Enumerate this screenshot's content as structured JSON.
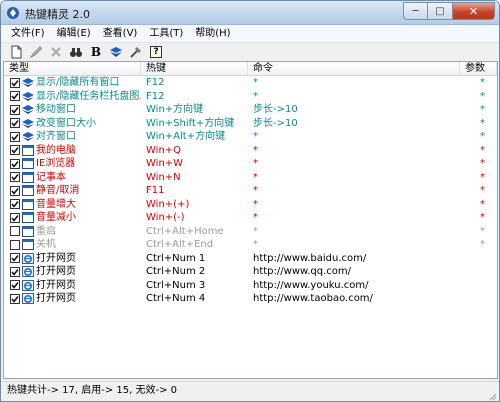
{
  "window": {
    "title": "热键精灵 2.0",
    "min_glyph": "─",
    "max_glyph": "□",
    "close_glyph": "✕"
  },
  "menu": [
    "文件(F)",
    "编辑(E)",
    "查看(V)",
    "工具(T)",
    "帮助(H)"
  ],
  "toolbar": {
    "icons": [
      "new-icon",
      "edit-icon",
      "delete-icon",
      "find-icon",
      "bold-icon",
      "hide-icon",
      "options-icon",
      "help-icon"
    ],
    "bold_glyph": "B",
    "help_glyph": "?"
  },
  "columns": [
    "类型",
    "热键",
    "命令",
    "参数"
  ],
  "colors": {
    "teal": "#0a8a8a",
    "red": "#d40000",
    "gray": "#9a9a9a",
    "black": "#000000"
  },
  "rows": [
    {
      "type": "显示/隐藏所有窗口",
      "hotkey": "F12",
      "command": "*",
      "param": "*",
      "checked": true,
      "icon": "diamond-icon",
      "color": "#0a8a8a"
    },
    {
      "type": "显示/隐藏任务栏托盘图...",
      "hotkey": "F12",
      "command": "*",
      "param": "*",
      "checked": true,
      "icon": "diamond-icon",
      "color": "#0a8a8a"
    },
    {
      "type": "移动窗口",
      "hotkey": "Win+方向键",
      "command": "步长->10",
      "param": "*",
      "checked": true,
      "icon": "diamond-icon",
      "color": "#0a8a8a"
    },
    {
      "type": "改变窗口大小",
      "hotkey": "Win+Shift+方向键",
      "command": "步长->10",
      "param": "*",
      "checked": true,
      "icon": "diamond-icon",
      "color": "#0a8a8a"
    },
    {
      "type": "对齐窗口",
      "hotkey": "Win+Alt+方向键",
      "command": "*",
      "param": "*",
      "checked": true,
      "icon": "diamond-icon",
      "color": "#0a8a8a"
    },
    {
      "type": "我的电脑",
      "hotkey": "Win+Q",
      "command": "*",
      "param": "*",
      "checked": true,
      "icon": "window-icon",
      "color": "#d40000"
    },
    {
      "type": "IE浏览器",
      "hotkey": "Win+W",
      "command": "*",
      "param": "*",
      "checked": true,
      "icon": "window-icon",
      "color": "#d40000"
    },
    {
      "type": "记事本",
      "hotkey": "Win+N",
      "command": "*",
      "param": "*",
      "checked": true,
      "icon": "window-icon",
      "color": "#d40000"
    },
    {
      "type": "静音/取消",
      "hotkey": "F11",
      "command": "*",
      "param": "*",
      "checked": true,
      "icon": "window-icon",
      "color": "#d40000"
    },
    {
      "type": "音量增大",
      "hotkey": "Win+(+)",
      "command": "*",
      "param": "*",
      "checked": true,
      "icon": "window-icon",
      "color": "#d40000"
    },
    {
      "type": "音量减小",
      "hotkey": "Win+(-)",
      "command": "*",
      "param": "*",
      "checked": true,
      "icon": "window-icon",
      "color": "#d40000"
    },
    {
      "type": "重启",
      "hotkey": "Ctrl+Alt+Home",
      "command": "*",
      "param": "*",
      "checked": false,
      "icon": "window-icon",
      "color": "#9a9a9a"
    },
    {
      "type": "关机",
      "hotkey": "Ctrl+Alt+End",
      "command": "*",
      "param": "*",
      "checked": false,
      "icon": "window-icon",
      "color": "#9a9a9a"
    },
    {
      "type": "打开网页",
      "hotkey": "Ctrl+Num 1",
      "command": "http://www.baidu.com/",
      "param": "",
      "checked": true,
      "icon": "ie-icon",
      "color": "#000000"
    },
    {
      "type": "打开网页",
      "hotkey": "Ctrl+Num 2",
      "command": "http://www.qq.com/",
      "param": "",
      "checked": true,
      "icon": "ie-icon",
      "color": "#000000"
    },
    {
      "type": "打开网页",
      "hotkey": "Ctrl+Num 3",
      "command": "http://www.youku.com/",
      "param": "",
      "checked": true,
      "icon": "ie-icon",
      "color": "#000000"
    },
    {
      "type": "打开网页",
      "hotkey": "Ctrl+Num 4",
      "command": "http://www.taobao.com/",
      "param": "",
      "checked": true,
      "icon": "ie-icon",
      "color": "#000000"
    }
  ],
  "status": "热键共计-> 17, 启用-> 15, 无效-> 0"
}
